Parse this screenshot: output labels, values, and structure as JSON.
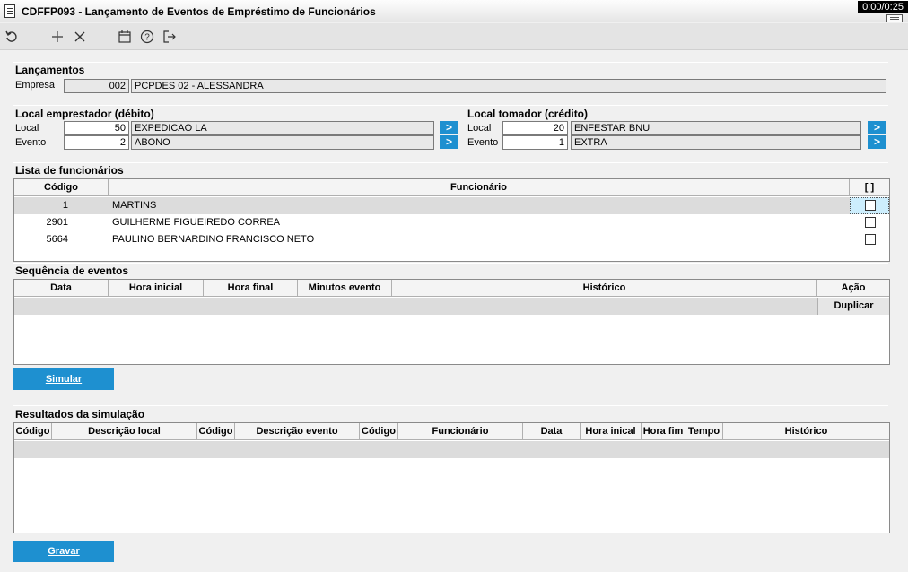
{
  "window": {
    "title": "CDFFP093 - Lançamento de Eventos de Empréstimo de Funcionários",
    "timer": "0:00/0:25"
  },
  "toolbar": {
    "refresh_icon": "refresh-icon",
    "add_icon": "plus-icon",
    "delete_icon": "close-icon",
    "calendar_icon": "calendar-icon",
    "help_icon": "help-icon",
    "exit_icon": "exit-icon"
  },
  "lancamentos": {
    "title": "Lançamentos",
    "empresa_label": "Empresa",
    "empresa_code": "002",
    "empresa_name": "PCPDES 02 - ALESSANDRA"
  },
  "emprestador": {
    "title": "Local emprestador (débito)",
    "local_label": "Local",
    "local_value": "50",
    "local_desc": "EXPEDICAO LA",
    "evento_label": "Evento",
    "evento_value": "2",
    "evento_desc": "ABONO"
  },
  "tomador": {
    "title": "Local tomador (crédito)",
    "local_label": "Local",
    "local_value": "20",
    "local_desc": "ENFESTAR BNU",
    "evento_label": "Evento",
    "evento_value": "1",
    "evento_desc": "EXTRA"
  },
  "go_glyph": ">",
  "funcionarios": {
    "title": "Lista de funcionários",
    "headers": [
      "Código",
      "Funcionário",
      "[ ]"
    ],
    "rows": [
      {
        "codigo": "1",
        "nome": "MARTINS"
      },
      {
        "codigo": "2901",
        "nome": "GUILHERME FIGUEIREDO CORREA"
      },
      {
        "codigo": "5664",
        "nome": "PAULINO BERNARDINO FRANCISCO NETO"
      }
    ]
  },
  "sequencia": {
    "title": "Sequência de eventos",
    "headers": [
      "Data",
      "Hora inicial",
      "Hora final",
      "Minutos evento",
      "Histórico",
      "Ação"
    ],
    "duplicar_label": "Duplicar"
  },
  "simular_label": "Simular",
  "resultados": {
    "title": "Resultados da simulação",
    "headers": [
      "Código",
      "Descrição local",
      "Código",
      "Descrição evento",
      "Código",
      "Funcionário",
      "Data",
      "Hora inical",
      "Hora fim",
      "Tempo",
      "Histórico"
    ]
  },
  "gravar_label": "Gravar",
  "colors": {
    "accent": "#1e90d0",
    "selected_row": "#dcdcdc",
    "checkbox_highlight": "#cdeefd"
  }
}
